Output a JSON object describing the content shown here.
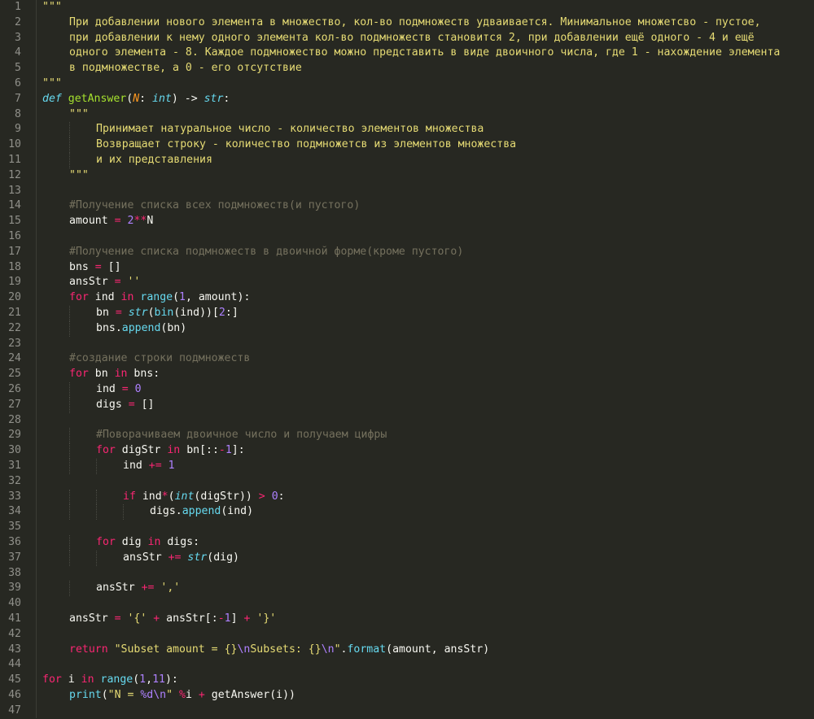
{
  "editor": {
    "theme": {
      "background": "#272822",
      "foreground": "#f8f8f2",
      "comment": "#75715e",
      "string": "#e6db74",
      "keyword": "#f92672",
      "builtin": "#66d9ef",
      "function": "#a6e22e",
      "number": "#ae81ff",
      "param": "#fd971f",
      "gutter_text": "#90908a"
    },
    "lines": [
      {
        "n": "1",
        "indent": 0,
        "tokens": [
          [
            "str",
            "\"\"\""
          ]
        ]
      },
      {
        "n": "2",
        "indent": 1,
        "tokens": [
          [
            "str",
            "При добавлении нового элемента в множество, кол-во подмножеств удваивается. Минимальное множетсво - пустое,"
          ]
        ]
      },
      {
        "n": "3",
        "indent": 1,
        "tokens": [
          [
            "str",
            "при добавлении к нему одного элемента кол-во подмножеств становится 2, при добавлении ещё одного - 4 и ещё"
          ]
        ]
      },
      {
        "n": "4",
        "indent": 1,
        "tokens": [
          [
            "str",
            "одного элемента - 8. Каждое подмножество можно представить в виде двоичного числа, где 1 - нахождение элемента"
          ]
        ]
      },
      {
        "n": "5",
        "indent": 1,
        "tokens": [
          [
            "str",
            "в подмножестве, а 0 - его отсутствие"
          ]
        ]
      },
      {
        "n": "6",
        "indent": 0,
        "tokens": [
          [
            "str",
            "\"\"\""
          ]
        ]
      },
      {
        "n": "7",
        "indent": 0,
        "tokens": [
          [
            "def",
            "def"
          ],
          [
            "norm",
            " "
          ],
          [
            "fn",
            "getAnswer"
          ],
          [
            "norm",
            "("
          ],
          [
            "par",
            "N"
          ],
          [
            "norm",
            ": "
          ],
          [
            "bi",
            "int"
          ],
          [
            "norm",
            ") -> "
          ],
          [
            "bi",
            "str"
          ],
          [
            "norm",
            ":"
          ]
        ]
      },
      {
        "n": "8",
        "indent": 1,
        "tokens": [
          [
            "str",
            "\"\"\""
          ]
        ]
      },
      {
        "n": "9",
        "indent": 2,
        "tokens": [
          [
            "str",
            "Принимает натуральное число - количество элементов множества"
          ]
        ]
      },
      {
        "n": "10",
        "indent": 2,
        "tokens": [
          [
            "str",
            "Возвращает строку - количество подмножетсв из элементов множества"
          ]
        ]
      },
      {
        "n": "11",
        "indent": 2,
        "tokens": [
          [
            "str",
            "и их представления"
          ]
        ]
      },
      {
        "n": "12",
        "indent": 1,
        "tokens": [
          [
            "str",
            "\"\"\""
          ]
        ]
      },
      {
        "n": "13",
        "indent": 0,
        "tokens": []
      },
      {
        "n": "14",
        "indent": 1,
        "tokens": [
          [
            "cmt",
            "#Получение списка всех подмножеств(и пустого)"
          ]
        ]
      },
      {
        "n": "15",
        "indent": 1,
        "tokens": [
          [
            "norm",
            "amount "
          ],
          [
            "op",
            "="
          ],
          [
            "norm",
            " "
          ],
          [
            "num",
            "2"
          ],
          [
            "op",
            "**"
          ],
          [
            "norm",
            "N"
          ]
        ]
      },
      {
        "n": "16",
        "indent": 0,
        "tokens": []
      },
      {
        "n": "17",
        "indent": 1,
        "tokens": [
          [
            "cmt",
            "#Получение списка подмножеств в двоичной форме(кроме пустого)"
          ]
        ]
      },
      {
        "n": "18",
        "indent": 1,
        "tokens": [
          [
            "norm",
            "bns "
          ],
          [
            "op",
            "="
          ],
          [
            "norm",
            " []"
          ]
        ]
      },
      {
        "n": "19",
        "indent": 1,
        "tokens": [
          [
            "norm",
            "ansStr "
          ],
          [
            "op",
            "="
          ],
          [
            "norm",
            " "
          ],
          [
            "str",
            "''"
          ]
        ]
      },
      {
        "n": "20",
        "indent": 1,
        "tokens": [
          [
            "kw",
            "for"
          ],
          [
            "norm",
            " ind "
          ],
          [
            "kw",
            "in"
          ],
          [
            "norm",
            " "
          ],
          [
            "call",
            "range"
          ],
          [
            "norm",
            "("
          ],
          [
            "num",
            "1"
          ],
          [
            "norm",
            ", amount):"
          ]
        ]
      },
      {
        "n": "21",
        "indent": 2,
        "tokens": [
          [
            "norm",
            "bn "
          ],
          [
            "op",
            "="
          ],
          [
            "norm",
            " "
          ],
          [
            "bi",
            "str"
          ],
          [
            "norm",
            "("
          ],
          [
            "call",
            "bin"
          ],
          [
            "norm",
            "(ind))["
          ],
          [
            "num",
            "2"
          ],
          [
            "norm",
            ":]"
          ]
        ]
      },
      {
        "n": "22",
        "indent": 2,
        "tokens": [
          [
            "norm",
            "bns."
          ],
          [
            "call",
            "append"
          ],
          [
            "norm",
            "(bn)"
          ]
        ]
      },
      {
        "n": "23",
        "indent": 0,
        "tokens": []
      },
      {
        "n": "24",
        "indent": 1,
        "tokens": [
          [
            "cmt",
            "#создание строки подмножеств"
          ]
        ]
      },
      {
        "n": "25",
        "indent": 1,
        "tokens": [
          [
            "kw",
            "for"
          ],
          [
            "norm",
            " bn "
          ],
          [
            "kw",
            "in"
          ],
          [
            "norm",
            " bns:"
          ]
        ]
      },
      {
        "n": "26",
        "indent": 2,
        "tokens": [
          [
            "norm",
            "ind "
          ],
          [
            "op",
            "="
          ],
          [
            "norm",
            " "
          ],
          [
            "num",
            "0"
          ]
        ]
      },
      {
        "n": "27",
        "indent": 2,
        "tokens": [
          [
            "norm",
            "digs "
          ],
          [
            "op",
            "="
          ],
          [
            "norm",
            " []"
          ]
        ]
      },
      {
        "n": "28",
        "indent": 0,
        "tokens": []
      },
      {
        "n": "29",
        "indent": 2,
        "tokens": [
          [
            "cmt",
            "#Поворачиваем двоичное число и получаем цифры"
          ]
        ]
      },
      {
        "n": "30",
        "indent": 2,
        "tokens": [
          [
            "kw",
            "for"
          ],
          [
            "norm",
            " digStr "
          ],
          [
            "kw",
            "in"
          ],
          [
            "norm",
            " bn[::"
          ],
          [
            "op",
            "-"
          ],
          [
            "num",
            "1"
          ],
          [
            "norm",
            "]:"
          ]
        ]
      },
      {
        "n": "31",
        "indent": 3,
        "tokens": [
          [
            "norm",
            "ind "
          ],
          [
            "op",
            "+="
          ],
          [
            "norm",
            " "
          ],
          [
            "num",
            "1"
          ]
        ]
      },
      {
        "n": "32",
        "indent": 0,
        "tokens": []
      },
      {
        "n": "33",
        "indent": 3,
        "tokens": [
          [
            "kw",
            "if"
          ],
          [
            "norm",
            " ind"
          ],
          [
            "op",
            "*"
          ],
          [
            "norm",
            "("
          ],
          [
            "bi",
            "int"
          ],
          [
            "norm",
            "(digStr)) "
          ],
          [
            "op",
            ">"
          ],
          [
            "norm",
            " "
          ],
          [
            "num",
            "0"
          ],
          [
            "norm",
            ":"
          ]
        ]
      },
      {
        "n": "34",
        "indent": 4,
        "tokens": [
          [
            "norm",
            "digs."
          ],
          [
            "call",
            "append"
          ],
          [
            "norm",
            "(ind)"
          ]
        ]
      },
      {
        "n": "35",
        "indent": 0,
        "tokens": []
      },
      {
        "n": "36",
        "indent": 2,
        "tokens": [
          [
            "kw",
            "for"
          ],
          [
            "norm",
            " dig "
          ],
          [
            "kw",
            "in"
          ],
          [
            "norm",
            " digs:"
          ]
        ]
      },
      {
        "n": "37",
        "indent": 3,
        "tokens": [
          [
            "norm",
            "ansStr "
          ],
          [
            "op",
            "+="
          ],
          [
            "norm",
            " "
          ],
          [
            "bi",
            "str"
          ],
          [
            "norm",
            "(dig)"
          ]
        ]
      },
      {
        "n": "38",
        "indent": 0,
        "tokens": []
      },
      {
        "n": "39",
        "indent": 2,
        "tokens": [
          [
            "norm",
            "ansStr "
          ],
          [
            "op",
            "+="
          ],
          [
            "norm",
            " "
          ],
          [
            "str",
            "','"
          ]
        ]
      },
      {
        "n": "40",
        "indent": 0,
        "tokens": []
      },
      {
        "n": "41",
        "indent": 1,
        "tokens": [
          [
            "norm",
            "ansStr "
          ],
          [
            "op",
            "="
          ],
          [
            "norm",
            " "
          ],
          [
            "str",
            "'{'"
          ],
          [
            "norm",
            " "
          ],
          [
            "op",
            "+"
          ],
          [
            "norm",
            " ansStr[:"
          ],
          [
            "op",
            "-"
          ],
          [
            "num",
            "1"
          ],
          [
            "norm",
            "] "
          ],
          [
            "op",
            "+"
          ],
          [
            "norm",
            " "
          ],
          [
            "str",
            "'}'"
          ]
        ]
      },
      {
        "n": "42",
        "indent": 0,
        "tokens": []
      },
      {
        "n": "43",
        "indent": 1,
        "tokens": [
          [
            "kw",
            "return"
          ],
          [
            "norm",
            " "
          ],
          [
            "str",
            "\"Subset amount = {}"
          ],
          [
            "esc",
            "\\n"
          ],
          [
            "str",
            "Subsets: {}"
          ],
          [
            "esc",
            "\\n"
          ],
          [
            "str",
            "\""
          ],
          [
            "norm",
            "."
          ],
          [
            "call",
            "format"
          ],
          [
            "norm",
            "(amount, ansStr)"
          ]
        ]
      },
      {
        "n": "44",
        "indent": 0,
        "tokens": []
      },
      {
        "n": "45",
        "indent": 0,
        "tokens": [
          [
            "kw",
            "for"
          ],
          [
            "norm",
            " i "
          ],
          [
            "kw",
            "in"
          ],
          [
            "norm",
            " "
          ],
          [
            "call",
            "range"
          ],
          [
            "norm",
            "("
          ],
          [
            "num",
            "1"
          ],
          [
            "norm",
            ","
          ],
          [
            "num",
            "11"
          ],
          [
            "norm",
            "):"
          ]
        ]
      },
      {
        "n": "46",
        "indent": 1,
        "tokens": [
          [
            "call",
            "print"
          ],
          [
            "norm",
            "("
          ],
          [
            "str",
            "\"N = "
          ],
          [
            "esc",
            "%d\\n"
          ],
          [
            "str",
            "\""
          ],
          [
            "norm",
            " "
          ],
          [
            "op",
            "%"
          ],
          [
            "norm",
            "i "
          ],
          [
            "op",
            "+"
          ],
          [
            "norm",
            " getAnswer(i))"
          ]
        ]
      },
      {
        "n": "47",
        "indent": 0,
        "tokens": []
      }
    ]
  }
}
